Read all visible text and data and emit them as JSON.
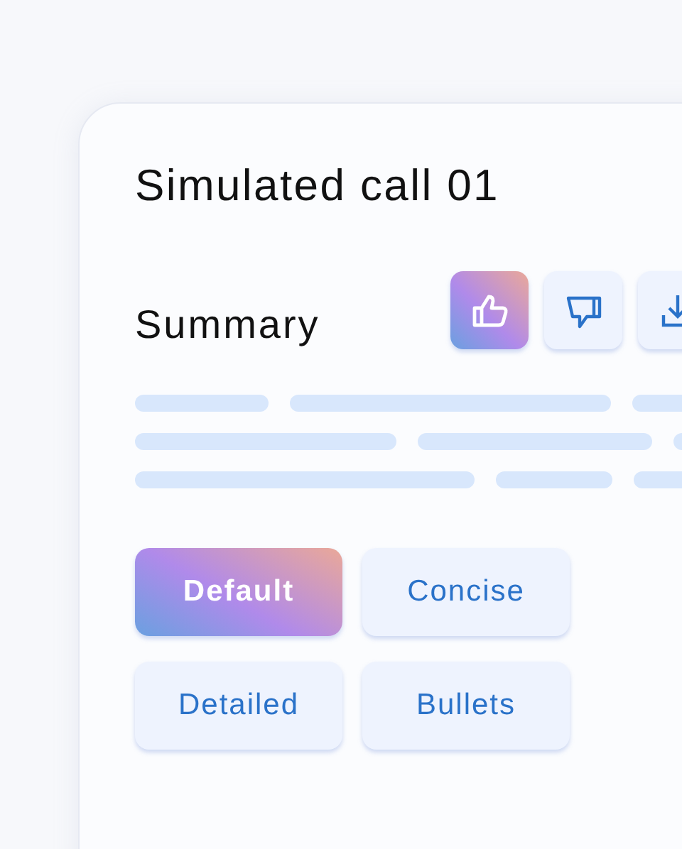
{
  "title": "Simulated call 01",
  "summary": {
    "heading": "Summary",
    "feedback": [
      {
        "kind": "like",
        "selected": true
      },
      {
        "kind": "dislike",
        "selected": false
      },
      {
        "kind": "download",
        "selected": false
      }
    ]
  },
  "styles": [
    {
      "label": "Default",
      "selected": true
    },
    {
      "label": "Concise",
      "selected": false
    },
    {
      "label": "Detailed",
      "selected": false
    },
    {
      "label": "Bullets",
      "selected": false
    }
  ]
}
